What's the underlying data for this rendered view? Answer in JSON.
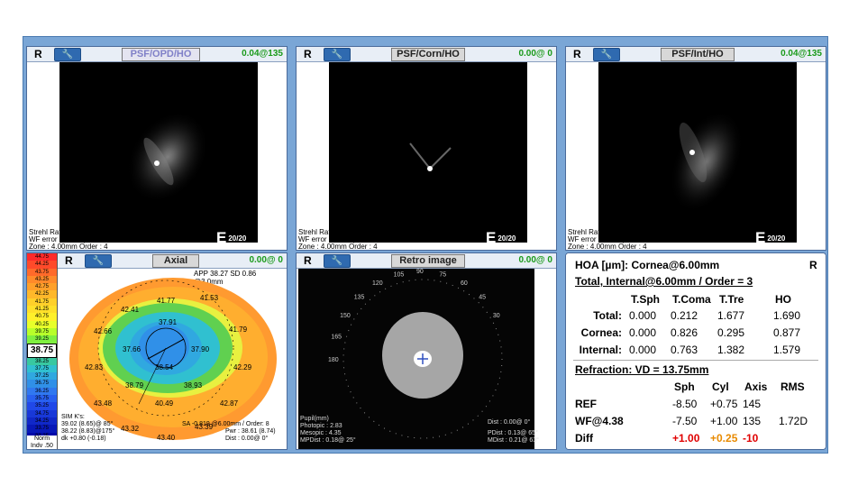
{
  "panels": {
    "psf1": {
      "eye": "R",
      "title": "PSF/OPD/HO",
      "value": "0.04@135",
      "strehl": "Strehl Ratio : 0.010",
      "wf": "WF error : 1.487 µm",
      "zone": "Zone : 4.00mm Order : 4",
      "acuity": "20/20",
      "e": "E"
    },
    "psf2": {
      "eye": "R",
      "title": "PSF/Corn/HO",
      "value": "0.00@  0",
      "strehl": "Strehl Ratio : 0.048",
      "wf": "WF error : 0.363 µm",
      "zone": "Zone : 4.00mm Order : 4",
      "acuity": "20/20",
      "e": "E"
    },
    "psf3": {
      "eye": "R",
      "title": "PSF/Int/HO",
      "value": "0.04@135",
      "strehl": "Strehl Ratio : 0.009",
      "wf": "WF error : 1.382 µm",
      "zone": "Zone : 4.00mm Order : 4",
      "acuity": "20/20",
      "e": "E"
    },
    "axial": {
      "eye": "R",
      "title": "Axial",
      "value": "0.00@  0",
      "app": "APP 38.27 SD 0.86 @3.0mm",
      "selected_value": "38.75",
      "norm": "Norm",
      "indv": "Indv .50",
      "simk_label": "SIM K's:",
      "simk1": "39.02 (8.65)@ 85°",
      "simk2": "38.22 (8.83)@175°",
      "dk": "dk +0.80 (-0.18)",
      "sa": "SA -0.819 @6.00mm / Order: 8",
      "pwr": "Pwr : 38.61 (8.74)",
      "dist": "Dist :  0.00@  0°",
      "colorbar": [
        "44.75",
        "44.25",
        "43.75",
        "43.25",
        "42.75",
        "42.25",
        "41.75",
        "41.25",
        "40.75",
        "40.25",
        "39.75",
        "39.25",
        "38.75",
        "38.25",
        "37.75",
        "37.25",
        "36.75",
        "36.25",
        "35.75",
        "35.25",
        "34.75",
        "34.25",
        "33.75",
        "33.25"
      ],
      "colorbar_colors": [
        "#ff2a2a",
        "#ff4a2a",
        "#ff6a2a",
        "#ff8a2a",
        "#ffa02a",
        "#ffb82a",
        "#ffd02a",
        "#ffe02a",
        "#fff02a",
        "#e8ff2a",
        "#b8ff2a",
        "#80f040",
        "#4ad84a",
        "#38c8a0",
        "#30c0d0",
        "#30a8e0",
        "#3090e8",
        "#3078f0",
        "#2860f0",
        "#2048e8",
        "#1838d8",
        "#1028c8",
        "#0818b8",
        "#0008a8"
      ],
      "map_values": [
        "41.77",
        "41.53",
        "42.41",
        "42.66",
        "41.79",
        "37.91",
        "37.66",
        "37.90",
        "42.83",
        "38.54",
        "42.29",
        "38.79",
        "38.93",
        "43.48",
        "40.49",
        "42.87",
        "43.32",
        "43.40",
        "43.39"
      ]
    },
    "retro": {
      "eye": "R",
      "title": "Retro image",
      "value": "0.00@  0",
      "pupil_label": "Pupil(mm)",
      "photopic": "Photopic : 2.83",
      "mesopic": "Mesopic : 4.35",
      "mpdist": "MPDist : 0.18@ 25°",
      "dist": "Dist : 0.00@  0°",
      "pdist": "PDist : 0.13@ 65°",
      "mdist": "MDist : 0.21@ 63°",
      "ticks": [
        "180",
        "165",
        "150",
        "135",
        "120",
        "105",
        "90",
        "75",
        "60",
        "45",
        "30"
      ]
    },
    "hoa": {
      "title": "HOA [µm]: Cornea@6.00mm",
      "eye": "R",
      "subtitle": "Total, Internal@6.00mm / Order = 3",
      "cols": [
        "T.Sph",
        "T.Coma",
        "T.Tre",
        "HO"
      ],
      "rows": [
        {
          "label": "Total:",
          "v": [
            "0.000",
            "0.212",
            "1.677",
            "1.690"
          ]
        },
        {
          "label": "Cornea:",
          "v": [
            "0.000",
            "0.826",
            "0.295",
            "0.877"
          ]
        },
        {
          "label": "Internal:",
          "v": [
            "0.000",
            "0.763",
            "1.382",
            "1.579"
          ]
        }
      ],
      "refraction": "Refraction: VD = 13.75mm",
      "rcols": [
        "Sph",
        "Cyl",
        "Axis",
        "RMS"
      ],
      "rrows": [
        {
          "label": "REF",
          "v": [
            "-8.50",
            "+0.75",
            "145",
            ""
          ]
        },
        {
          "label": "WF@4.38",
          "v": [
            "-7.50",
            "+1.00",
            "135",
            "1.72D"
          ]
        },
        {
          "label": "Diff",
          "v": [
            "+1.00",
            "+0.25",
            "-10",
            ""
          ]
        }
      ]
    }
  }
}
